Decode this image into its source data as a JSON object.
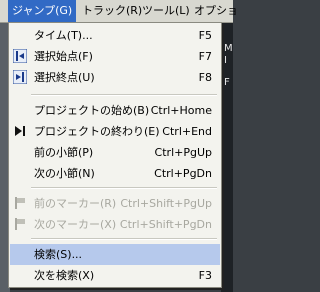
{
  "menubar": {
    "items": [
      {
        "label": "ジャンプ(G)",
        "active": true
      },
      {
        "label": "トラック(R)",
        "active": false
      },
      {
        "label": "ツール(L)",
        "active": false
      },
      {
        "label": "オプショ",
        "active": false
      }
    ]
  },
  "jump_menu": {
    "items": [
      {
        "label": "タイム(T)...",
        "shortcut": "F5",
        "icon": ""
      },
      {
        "label": "選択始点(F)",
        "shortcut": "F7",
        "icon": "selection-start-icon"
      },
      {
        "label": "選択終点(U)",
        "shortcut": "F8",
        "icon": "selection-end-icon"
      },
      {
        "label": "プロジェクトの始め(B)",
        "shortcut": "Ctrl+Home",
        "icon": ""
      },
      {
        "label": "プロジェクトの終わり(E)",
        "shortcut": "Ctrl+End",
        "icon": "project-end-icon"
      },
      {
        "label": "前の小節(P)",
        "shortcut": "Ctrl+PgUp",
        "icon": ""
      },
      {
        "label": "次の小節(N)",
        "shortcut": "Ctrl+PgDn",
        "icon": ""
      },
      {
        "label": "前のマーカー(R)",
        "shortcut": "Ctrl+Shift+PgUp",
        "icon": "prev-marker-icon",
        "disabled": true
      },
      {
        "label": "次のマーカー(X)",
        "shortcut": "Ctrl+Shift+PgDn",
        "icon": "next-marker-icon",
        "disabled": true
      },
      {
        "label": "検索(S)...",
        "shortcut": "",
        "icon": "",
        "highlighted": true
      },
      {
        "label": "次を検索(X)",
        "shortcut": "F3",
        "icon": ""
      }
    ]
  },
  "background": {
    "right_labels": [
      "M",
      "I",
      "F"
    ]
  }
}
